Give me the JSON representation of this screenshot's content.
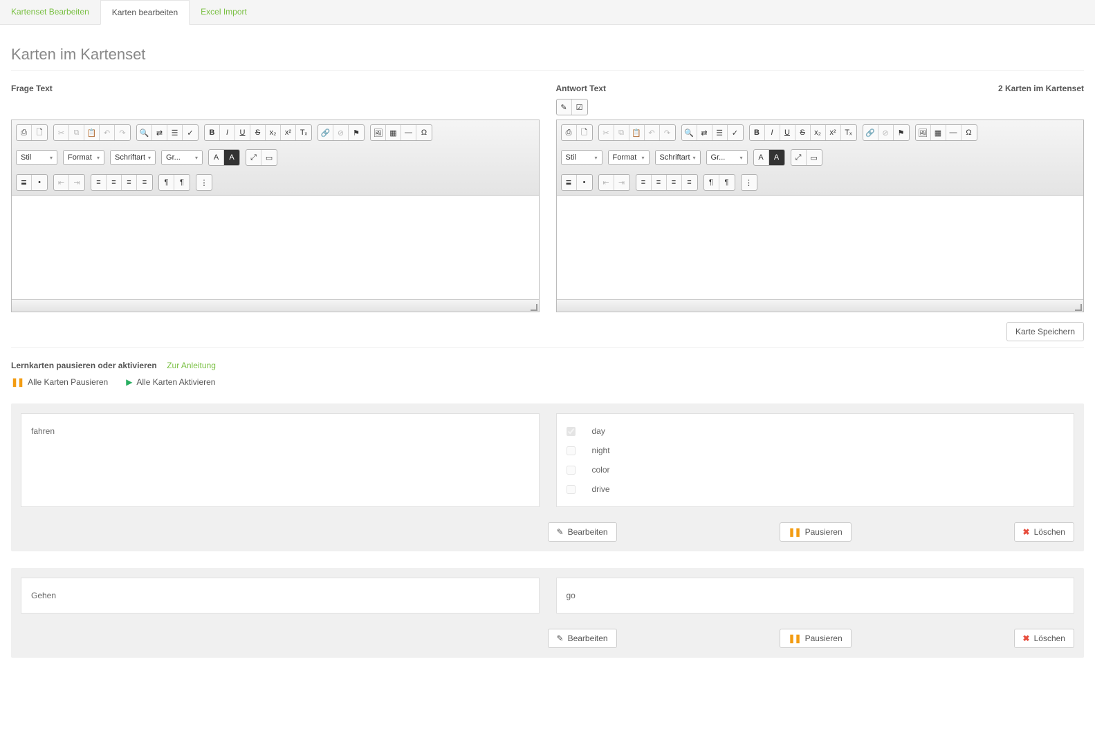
{
  "tabs": [
    {
      "label": "Kartenset Bearbeiten",
      "active": false
    },
    {
      "label": "Karten bearbeiten",
      "active": true
    },
    {
      "label": "Excel Import",
      "active": false
    }
  ],
  "page_title": "Karten im Kartenset",
  "editor_labels": {
    "question": "Frage Text",
    "answer": "Antwort Text",
    "count": "2 Karten im Kartenset"
  },
  "toolbar_combos": {
    "style": "Stil",
    "format": "Format",
    "font": "Schriftart",
    "size": "Gr..."
  },
  "save_button": "Karte Speichern",
  "pause_section": {
    "title": "Lernkarten pausieren oder aktivieren",
    "guide_link": "Zur Anleitung",
    "pause_all": "Alle Karten Pausieren",
    "activate_all": "Alle Karten Aktivieren"
  },
  "card_actions": {
    "edit": "Bearbeiten",
    "pause": "Pausieren",
    "delete": "Löschen"
  },
  "cards": [
    {
      "question": "fahren",
      "answer_type": "mc",
      "answers": [
        {
          "text": "day",
          "checked": true
        },
        {
          "text": "night",
          "checked": false
        },
        {
          "text": "color",
          "checked": false
        },
        {
          "text": "drive",
          "checked": false
        }
      ]
    },
    {
      "question": "Gehen",
      "answer_type": "text",
      "answer_text": "go"
    }
  ]
}
